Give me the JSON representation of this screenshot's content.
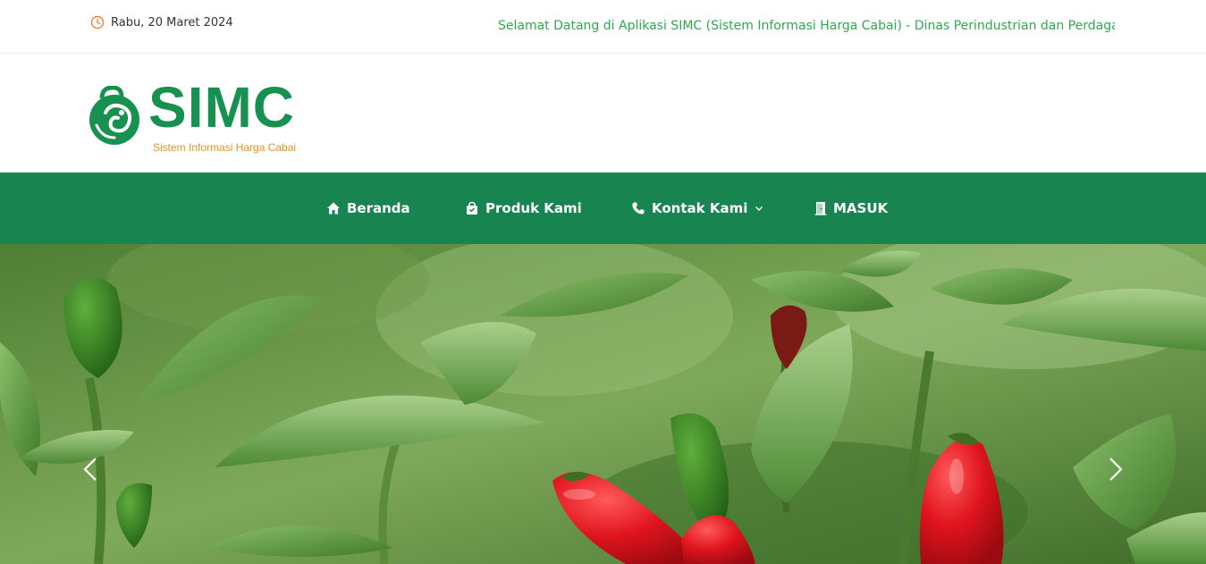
{
  "topbar": {
    "date": "Rabu, 20 Maret 2024",
    "ticker": "Selamat Datang di Aplikasi SIMC (Sistem Informasi Harga Cabai) - Dinas Perindustrian dan Perdagangan"
  },
  "logo": {
    "name": "SIMC",
    "tagline": "Sistem Informasi Harga Cabai"
  },
  "nav": {
    "home": "Beranda",
    "produk": "Produk Kami",
    "kontak": "Kontak Kami",
    "masuk": "MASUK"
  },
  "colors": {
    "brand_green": "#17914f",
    "nav_bg": "#188450",
    "ticker_green": "#2fa84f",
    "tagline_orange": "#e0932a",
    "chili_red": "#e0141e"
  },
  "icons": {
    "date": "clock-icon",
    "home": "home-icon",
    "produk": "shopping-bag-icon",
    "kontak": "phone-icon",
    "kontak_dropdown": "chevron-down-icon",
    "masuk": "door-icon",
    "slider_prev": "chevron-left-icon",
    "slider_next": "chevron-right-icon"
  }
}
